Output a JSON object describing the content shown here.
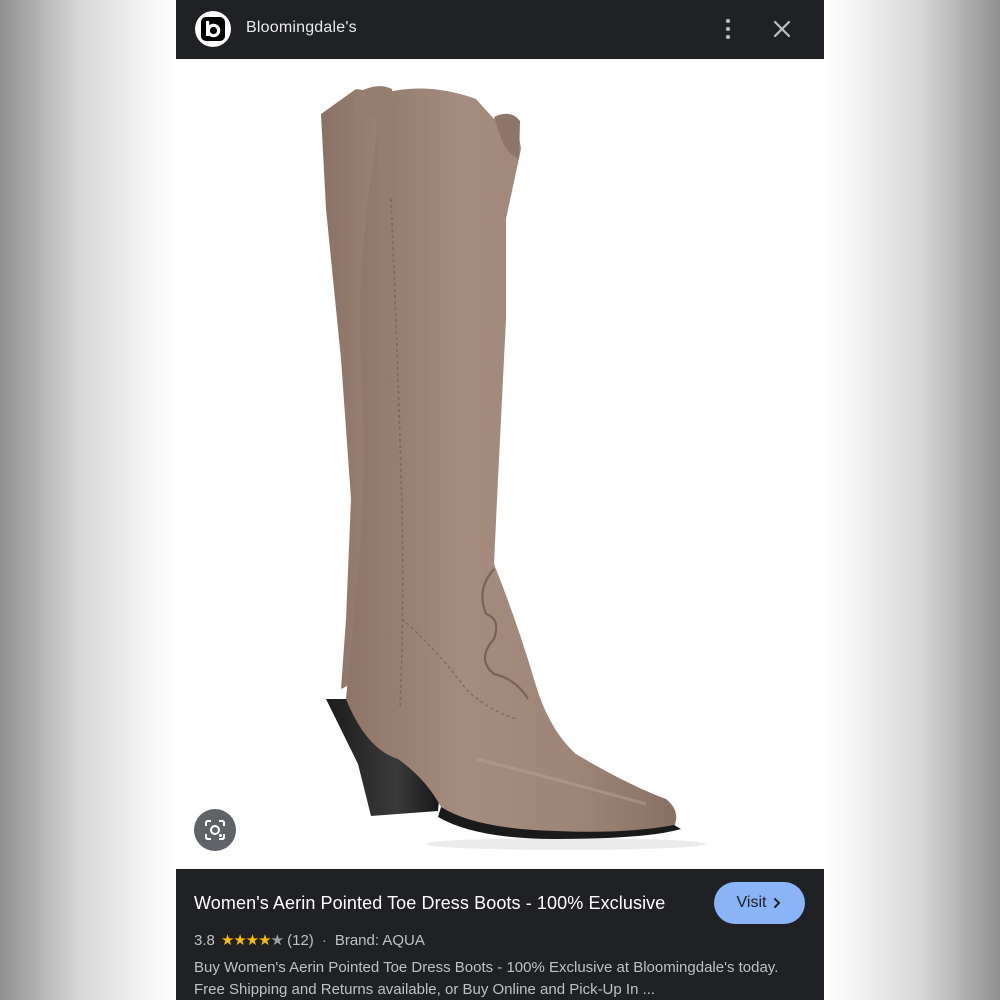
{
  "header": {
    "site_name": "Bloomingdale's",
    "logo_letter": "b",
    "more_icon": "more-vert-icon",
    "close_icon": "close-icon"
  },
  "image": {
    "subject": "boot-image",
    "lens_icon": "lens-icon",
    "suede_color": "#9e8576"
  },
  "result": {
    "title": "Women's Aerin Pointed Toe Dress Boots - 100% Exclusive",
    "visit_label": "Visit",
    "rating": "3.8",
    "rating_value": 3.8,
    "review_count": "(12)",
    "separator": "·",
    "brand": "Brand: AQUA",
    "description": "Buy Women's Aerin Pointed Toe Dress Boots - 100% Exclusive at Bloomingdale's today. Free Shipping and Returns available, or Buy Online and Pick-Up In ..."
  },
  "colors": {
    "panel": "#202124",
    "accent": "#8ab4f8",
    "star": "#fbbc04"
  }
}
